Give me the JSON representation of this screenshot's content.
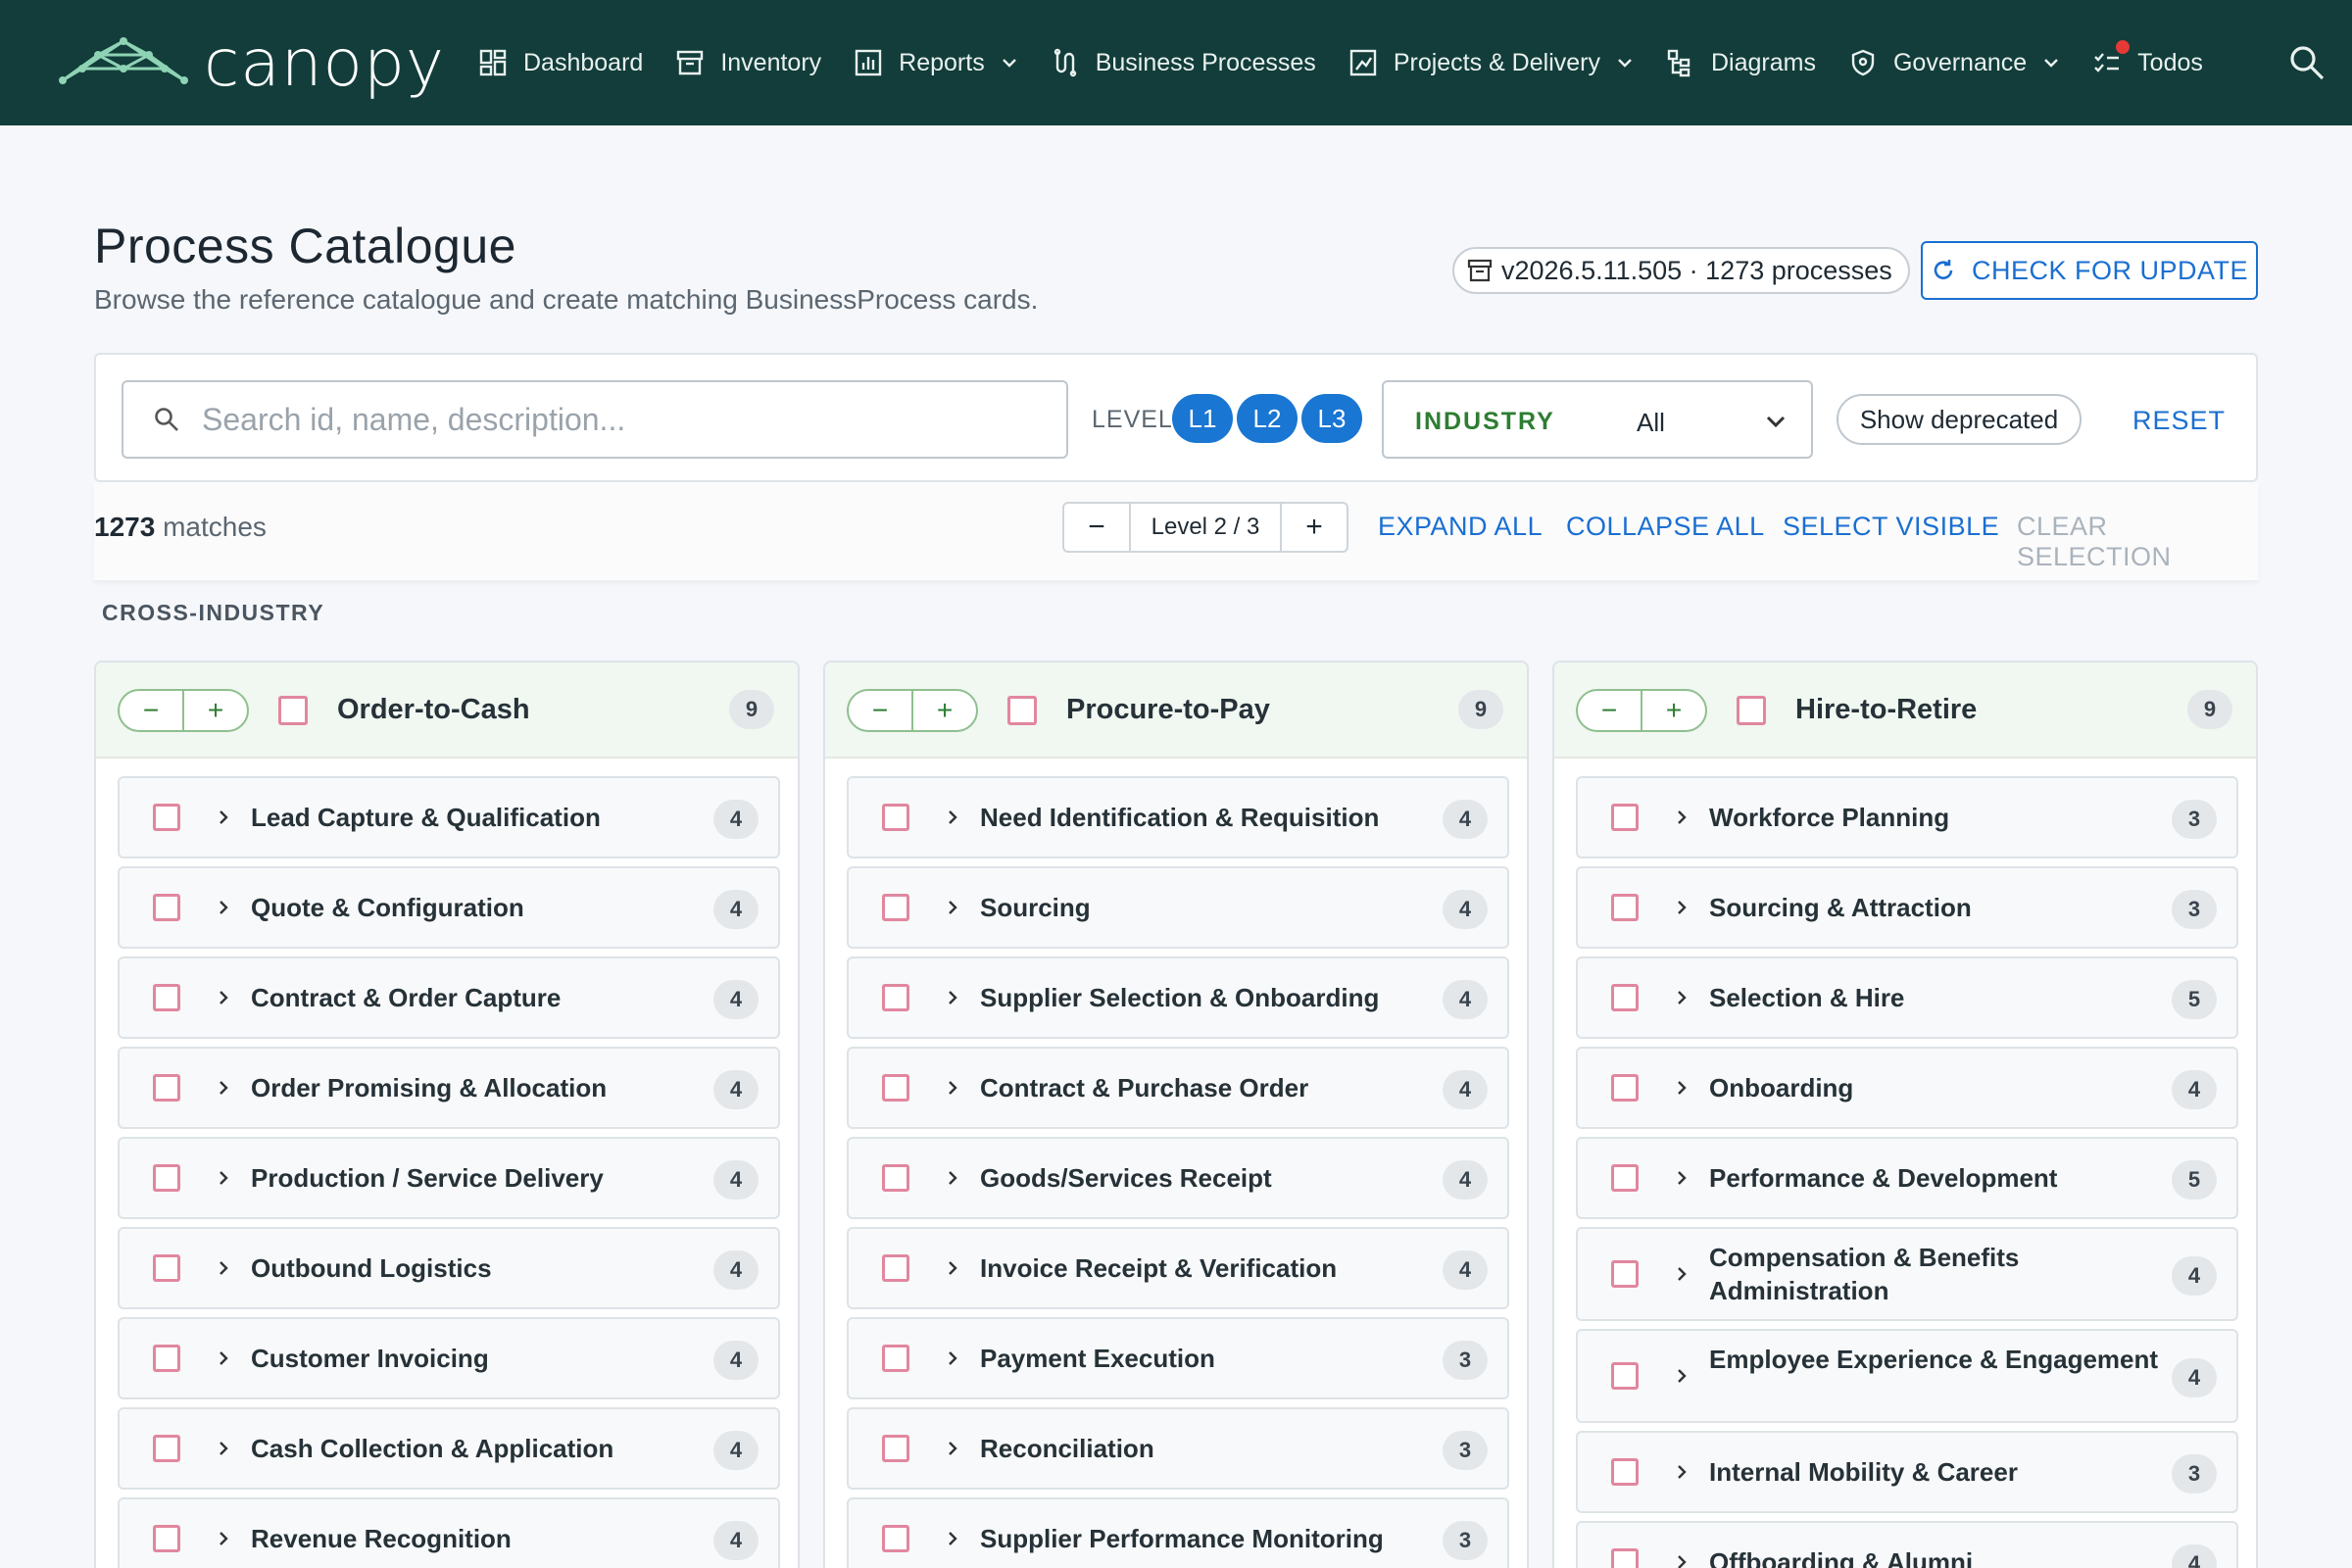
{
  "nav": {
    "brand": "canopy",
    "items": [
      {
        "label": "Dashboard",
        "icon": "dashboard-icon",
        "caret": false
      },
      {
        "label": "Inventory",
        "icon": "archive-icon",
        "caret": false
      },
      {
        "label": "Reports",
        "icon": "bar-chart-icon",
        "caret": true
      },
      {
        "label": "Business Processes",
        "icon": "process-icon",
        "caret": false
      },
      {
        "label": "Projects & Delivery",
        "icon": "project-icon",
        "caret": true
      },
      {
        "label": "Diagrams",
        "icon": "diagram-icon",
        "caret": false
      },
      {
        "label": "Governance",
        "icon": "shield-icon",
        "caret": true
      },
      {
        "label": "Todos",
        "icon": "todo-icon",
        "caret": false
      }
    ],
    "search_icon": "search-icon"
  },
  "header": {
    "title": "Process Catalogue",
    "subtitle": "Browse the reference catalogue and create matching BusinessProcess cards.",
    "version": "v2026.5.11.505 · 1273 processes",
    "update_button": "CHECK FOR UPDATE"
  },
  "filters": {
    "search_placeholder": "Search id, name, description...",
    "level_label": "LEVEL",
    "levels": [
      "L1",
      "L2",
      "L3"
    ],
    "industry_label": "INDUSTRY",
    "industry_value": "All",
    "deprecated_label": "Show deprecated",
    "reset_label": "RESET"
  },
  "toolbar": {
    "match_count": "1273",
    "match_suffix": " matches",
    "minus": "−",
    "level_display": "Level 2 / 3",
    "plus": "+",
    "expand_all": "EXPAND ALL",
    "collapse_all": "COLLAPSE ALL",
    "select_visible": "SELECT VISIBLE",
    "clear_selection": "CLEAR SELECTION"
  },
  "section": {
    "label": "CROSS-INDUSTRY"
  },
  "columns": [
    {
      "title": "Order-to-Cash",
      "count": "9",
      "rows": [
        {
          "title": "Lead Capture & Qualification",
          "count": "4"
        },
        {
          "title": "Quote & Configuration",
          "count": "4"
        },
        {
          "title": "Contract & Order Capture",
          "count": "4"
        },
        {
          "title": "Order Promising & Allocation",
          "count": "4"
        },
        {
          "title": "Production / Service Delivery",
          "count": "4"
        },
        {
          "title": "Outbound Logistics",
          "count": "4"
        },
        {
          "title": "Customer Invoicing",
          "count": "4"
        },
        {
          "title": "Cash Collection & Application",
          "count": "4"
        },
        {
          "title": "Revenue Recognition",
          "count": "4"
        }
      ]
    },
    {
      "title": "Procure-to-Pay",
      "count": "9",
      "rows": [
        {
          "title": "Need Identification & Requisition",
          "count": "4"
        },
        {
          "title": "Sourcing",
          "count": "4"
        },
        {
          "title": "Supplier Selection & Onboarding",
          "count": "4"
        },
        {
          "title": "Contract & Purchase Order",
          "count": "4"
        },
        {
          "title": "Goods/Services Receipt",
          "count": "4"
        },
        {
          "title": "Invoice Receipt & Verification",
          "count": "4"
        },
        {
          "title": "Payment Execution",
          "count": "3"
        },
        {
          "title": "Reconciliation",
          "count": "3"
        },
        {
          "title": "Supplier Performance Monitoring",
          "count": "3"
        }
      ]
    },
    {
      "title": "Hire-to-Retire",
      "count": "9",
      "rows": [
        {
          "title": "Workforce Planning",
          "count": "3"
        },
        {
          "title": "Sourcing & Attraction",
          "count": "3"
        },
        {
          "title": "Selection & Hire",
          "count": "5"
        },
        {
          "title": "Onboarding",
          "count": "4"
        },
        {
          "title": "Performance & Development",
          "count": "5"
        },
        {
          "title": "Compensation & Benefits Administration",
          "count": "4"
        },
        {
          "title": "Employee Experience & Engagement",
          "count": "4"
        },
        {
          "title": "Internal Mobility & Career",
          "count": "3"
        },
        {
          "title": "Offboarding & Alumni",
          "count": "4"
        }
      ]
    }
  ],
  "colors": {
    "nav_bg": "#123d3a",
    "accent": "#1a6fd1",
    "level_chip": "#1976d2",
    "industry_label": "#2e7d32",
    "checkbox": "#e1879f",
    "column_head_bg": "#f1f7f1"
  }
}
